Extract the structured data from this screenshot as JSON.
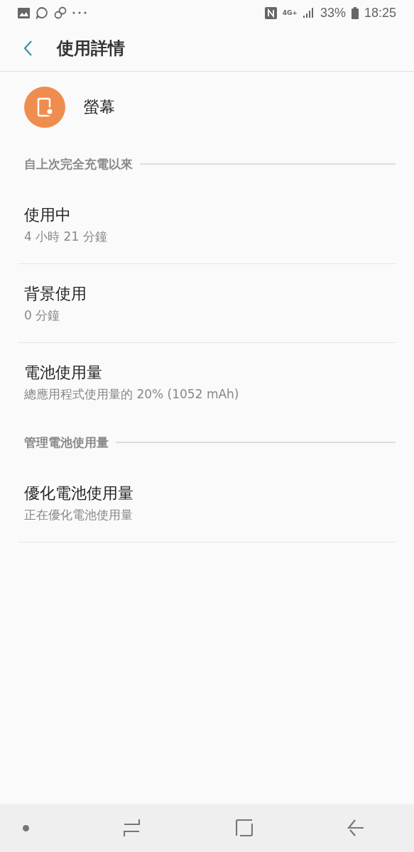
{
  "status_bar": {
    "network": "4G+",
    "battery": "33%",
    "time": "18:25"
  },
  "header": {
    "title": "使用詳情"
  },
  "app": {
    "name": "螢幕"
  },
  "sections": [
    {
      "title": "自上次完全充電以來",
      "items": [
        {
          "title": "使用中",
          "subtitle": "4 小時 21 分鐘"
        },
        {
          "title": "背景使用",
          "subtitle": "0 分鐘"
        },
        {
          "title": "電池使用量",
          "subtitle": "總應用程式使用量的 20% (1052 mAh)"
        }
      ]
    },
    {
      "title": "管理電池使用量",
      "items": [
        {
          "title": "優化電池使用量",
          "subtitle": "正在優化電池使用量"
        }
      ]
    }
  ]
}
